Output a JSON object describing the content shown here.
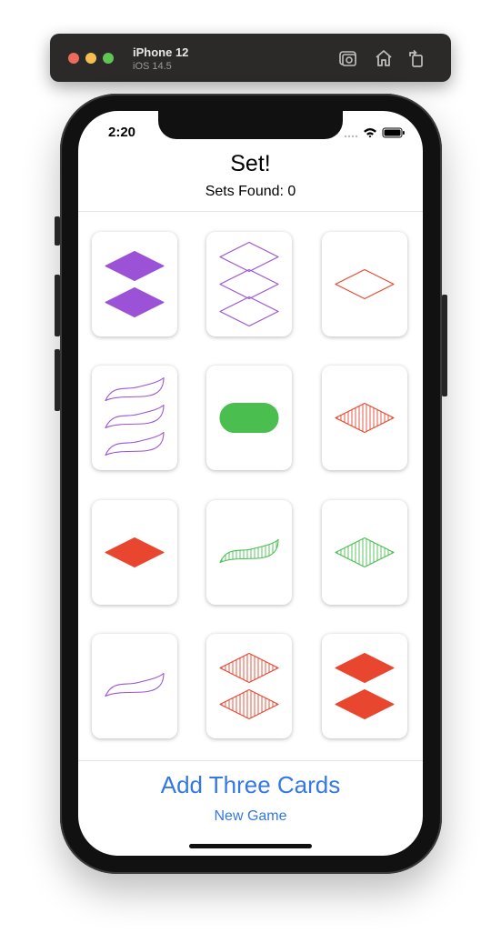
{
  "simulator": {
    "device_name": "iPhone 12",
    "os_version": "iOS 14.5",
    "icons": [
      "screenshot-icon",
      "home-icon",
      "rotate-icon"
    ]
  },
  "status_bar": {
    "time": "2:20",
    "icons": [
      "signal-icon",
      "wifi-icon",
      "battery-icon"
    ]
  },
  "header": {
    "title": "Set!",
    "sets_found": "Sets Found: 0"
  },
  "colors": {
    "purple": "#9b52d6",
    "green": "#4bbe50",
    "red": "#e8462e",
    "accent": "#3478e4"
  },
  "cards": [
    {
      "count": 2,
      "shape": "diamond",
      "shading": "solid",
      "color": "purple"
    },
    {
      "count": 3,
      "shape": "diamond",
      "shading": "open",
      "color": "purple"
    },
    {
      "count": 1,
      "shape": "diamond",
      "shading": "open",
      "color": "red"
    },
    {
      "count": 3,
      "shape": "squiggle",
      "shading": "open",
      "color": "purple"
    },
    {
      "count": 1,
      "shape": "oval",
      "shading": "solid",
      "color": "green"
    },
    {
      "count": 1,
      "shape": "diamond",
      "shading": "striped",
      "color": "red"
    },
    {
      "count": 1,
      "shape": "diamond",
      "shading": "solid",
      "color": "red"
    },
    {
      "count": 1,
      "shape": "squiggle",
      "shading": "striped",
      "color": "green"
    },
    {
      "count": 1,
      "shape": "diamond",
      "shading": "striped",
      "color": "green"
    },
    {
      "count": 1,
      "shape": "squiggle",
      "shading": "open",
      "color": "purple"
    },
    {
      "count": 2,
      "shape": "diamond",
      "shading": "striped",
      "color": "red"
    },
    {
      "count": 2,
      "shape": "diamond",
      "shading": "solid",
      "color": "red"
    }
  ],
  "actions": {
    "add_three_cards": "Add Three Cards",
    "new_game": "New Game"
  }
}
